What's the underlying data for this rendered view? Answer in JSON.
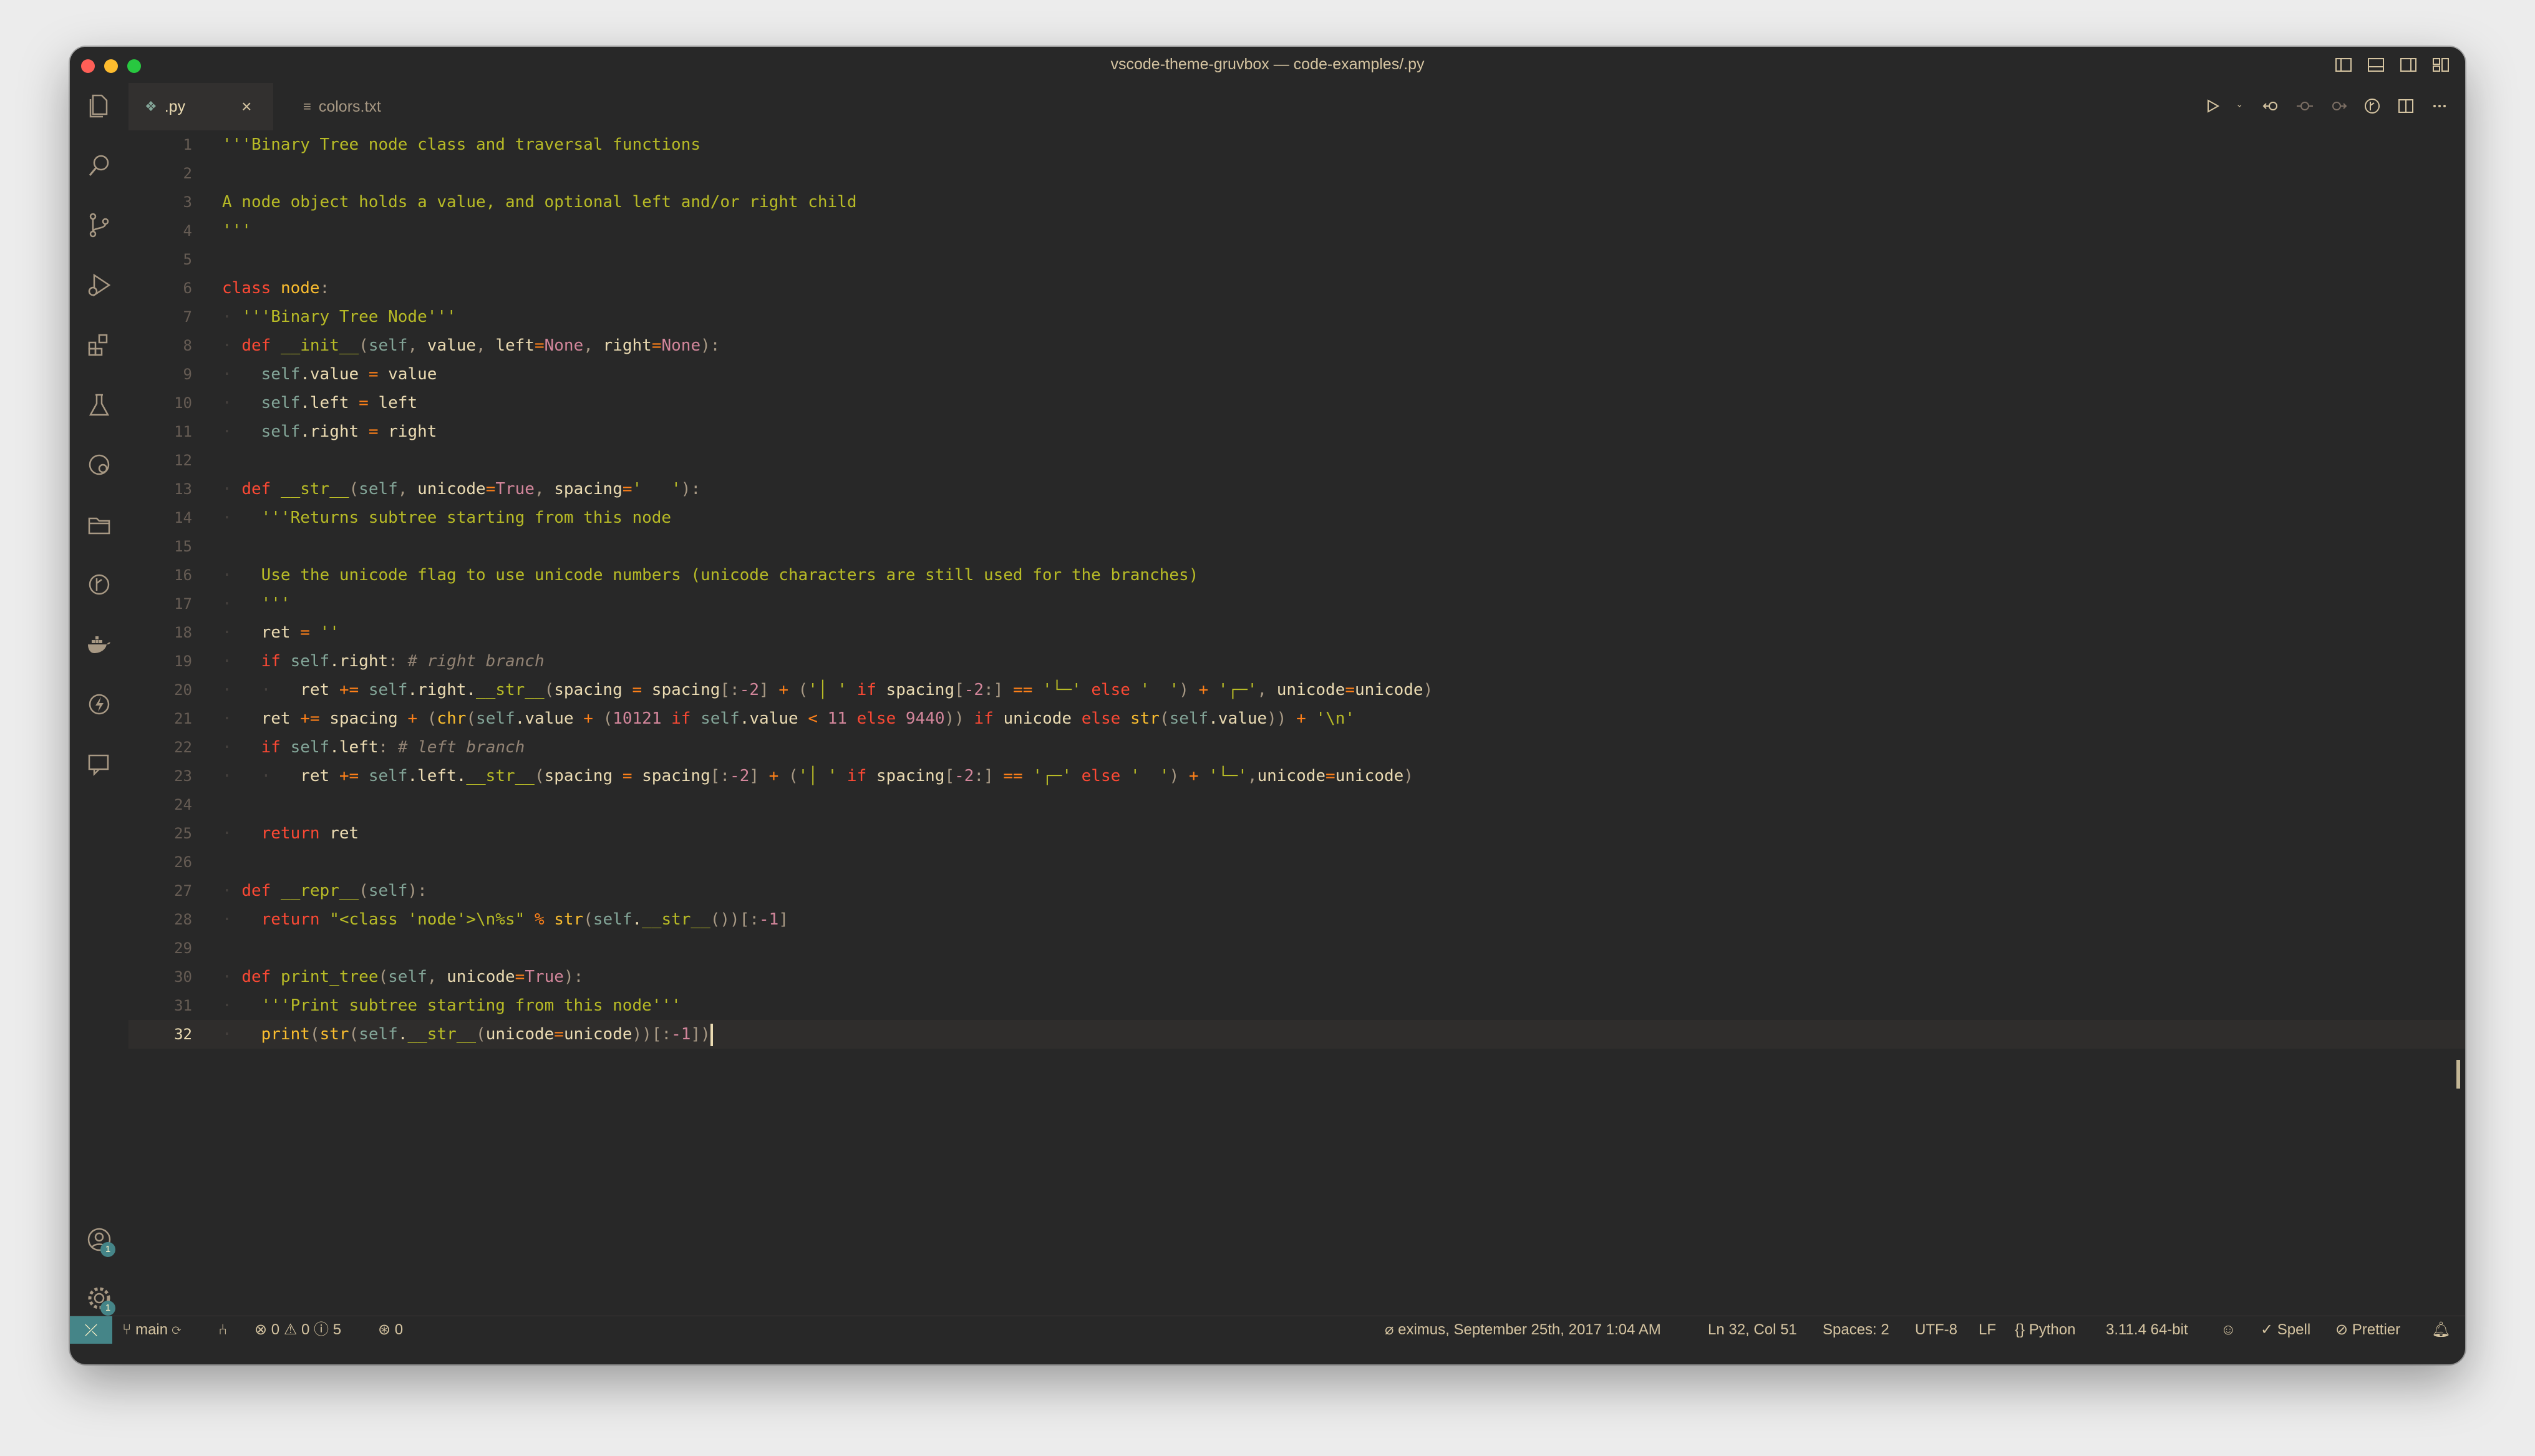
{
  "window": {
    "title": "vscode-theme-gruvbox — code-examples/.py"
  },
  "tabs": [
    {
      "label": ".py",
      "icon": "python-file-icon",
      "active": true
    },
    {
      "label": "colors.txt",
      "icon": "text-file-icon",
      "active": false
    }
  ],
  "activity_bar": [
    "explorer-icon",
    "search-icon",
    "source-control-icon",
    "run-debug-icon",
    "extensions-icon",
    "testing-icon",
    "remote-explorer-icon",
    "project-manager-icon",
    "git-graph-icon",
    "docker-icon",
    "thunder-client-icon",
    "live-share-icon",
    "accounts-icon",
    "settings-gear-icon"
  ],
  "badges": {
    "accounts": "1",
    "settings": "1"
  },
  "editor": {
    "line_numbers": [
      "1",
      "2",
      "3",
      "4",
      "5",
      "6",
      "7",
      "8",
      "9",
      "10",
      "11",
      "12",
      "13",
      "14",
      "15",
      "16",
      "17",
      "18",
      "19",
      "20",
      "21",
      "22",
      "23",
      "24",
      "25",
      "26",
      "27",
      "28",
      "29",
      "30",
      "31",
      "32"
    ],
    "current_line": "32"
  },
  "status_bar": {
    "branch": "main",
    "errors": "0",
    "warnings": "0",
    "infos": "5",
    "ports": "0",
    "blame": "eximus, September 25th, 2017 1:04 AM",
    "position": "Ln 32, Col 51",
    "spaces": "Spaces: 2",
    "encoding": "UTF-8",
    "eol": "LF",
    "language": "Python",
    "interpreter": "3.11.4 64-bit",
    "spell": "Spell",
    "prettier": "Prettier"
  },
  "colors": {
    "background": "#282828",
    "foreground": "#ebdbb2",
    "string": "#b8bb26",
    "keyword": "#fb4934",
    "accent": "#458588"
  }
}
